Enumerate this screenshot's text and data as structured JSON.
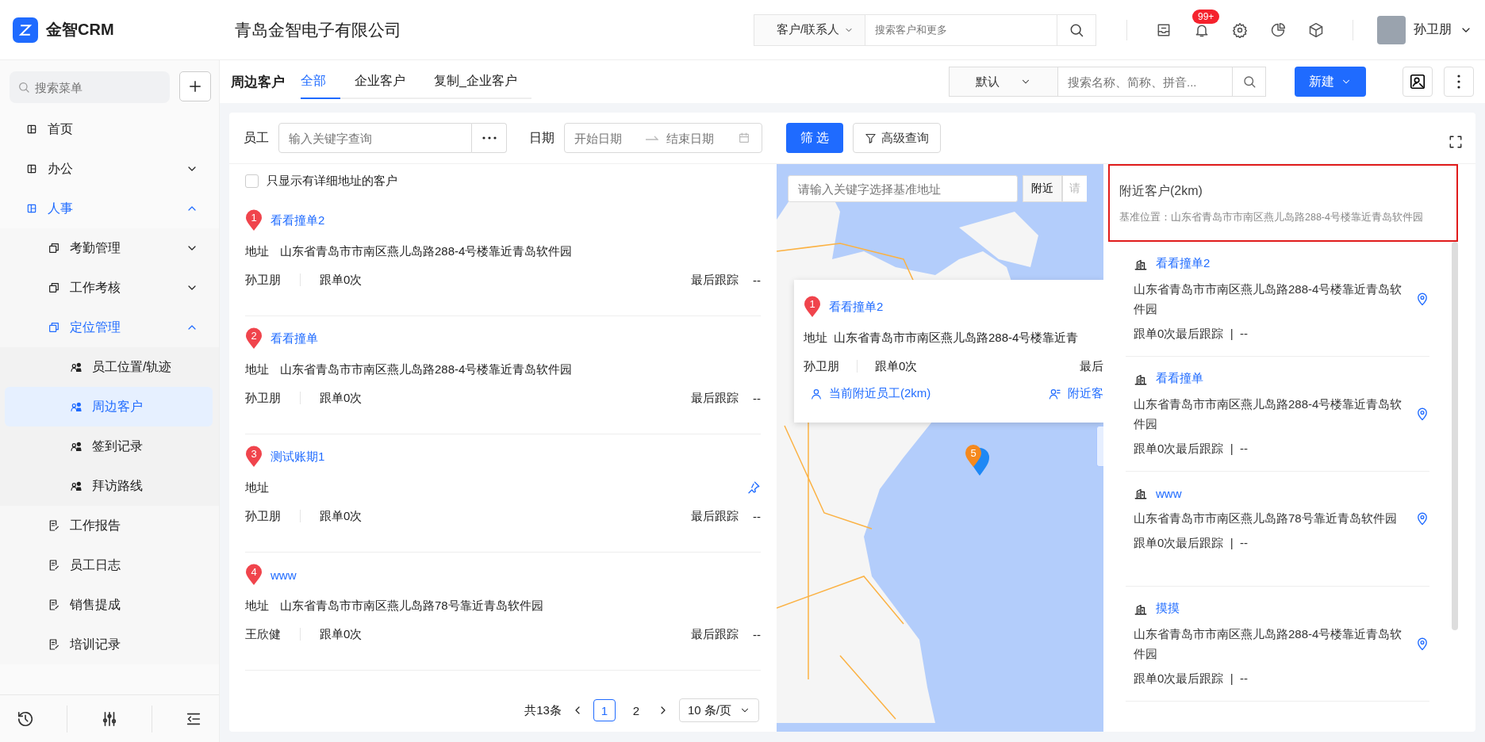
{
  "header": {
    "logo_text": "金智CRM",
    "company": "青岛金智电子有限公司",
    "search_scope": "客户/联系人",
    "search_placeholder": "搜索客户和更多",
    "notification_badge": "99+",
    "user_name": "孙卫朋"
  },
  "sidebar": {
    "search_placeholder": "搜索菜单",
    "items": [
      {
        "label": "首页",
        "kind": "leaf",
        "selected": false
      },
      {
        "label": "办公",
        "kind": "group",
        "expanded": false,
        "selected": false
      },
      {
        "label": "人事",
        "kind": "group",
        "expanded": true,
        "selected": false,
        "children": [
          {
            "label": "考勤管理",
            "kind": "group",
            "expanded": false,
            "selected": false
          },
          {
            "label": "工作考核",
            "kind": "group",
            "expanded": false,
            "selected": false
          },
          {
            "label": "定位管理",
            "kind": "group",
            "expanded": true,
            "selected": false,
            "children": [
              {
                "label": "员工位置/轨迹",
                "kind": "leaf",
                "selected": false
              },
              {
                "label": "周边客户",
                "kind": "leaf",
                "selected": true
              },
              {
                "label": "签到记录",
                "kind": "leaf",
                "selected": false
              },
              {
                "label": "拜访路线",
                "kind": "leaf",
                "selected": false
              }
            ]
          },
          {
            "label": "工作报告",
            "kind": "leaf",
            "selected": false
          },
          {
            "label": "员工日志",
            "kind": "leaf",
            "selected": false
          },
          {
            "label": "销售提成",
            "kind": "leaf",
            "selected": false
          },
          {
            "label": "培训记录",
            "kind": "leaf",
            "selected": false
          }
        ]
      }
    ]
  },
  "toolbar": {
    "title": "周边客户",
    "tabs": [
      {
        "label": "全部",
        "selected": true
      },
      {
        "label": "企业客户",
        "selected": false
      },
      {
        "label": "复制_企业客户",
        "selected": false
      }
    ],
    "view_select": "默认",
    "search_placeholder": "搜索名称、简称、拼音...",
    "new_button": "新建"
  },
  "filters": {
    "employee_label": "员工",
    "employee_placeholder": "输入关键字查询",
    "date_label": "日期",
    "start_placeholder": "开始日期",
    "end_placeholder": "结束日期",
    "filter_button": "筛 选",
    "advanced_button": "高级查询"
  },
  "list": {
    "checkbox": {
      "label": "只显示有详细地址的客户",
      "checked": false
    },
    "customers": [
      {
        "number": "1",
        "name": "看看撞单2",
        "address_label": "地址",
        "address": "山东省青岛市市南区燕儿岛路288-4号楼靠近青岛软件园",
        "owner": "孙卫朋",
        "follow": "跟单0次",
        "last_label": "最后跟踪",
        "last_value": "--"
      },
      {
        "number": "2",
        "name": "看看撞单",
        "address_label": "地址",
        "address": "山东省青岛市市南区燕儿岛路288-4号楼靠近青岛软件园",
        "owner": "孙卫朋",
        "follow": "跟单0次",
        "last_label": "最后跟踪",
        "last_value": "--"
      },
      {
        "number": "3",
        "name": "测试账期1",
        "address_label": "地址",
        "owner": "孙卫朋",
        "follow": "跟单0次",
        "last_label": "最后跟踪",
        "last_value": "--"
      },
      {
        "number": "4",
        "name": "www",
        "address_label": "地址",
        "address": "山东省青岛市市南区燕儿岛路78号靠近青岛软件园",
        "owner": "王欣健",
        "follow": "跟单0次",
        "last_label": "最后跟踪",
        "last_value": "--"
      }
    ]
  },
  "pagination": {
    "total": "共13条",
    "pages": [
      {
        "label": "1",
        "selected": true
      },
      {
        "label": "2",
        "selected": false
      }
    ],
    "page_size": "10 条/页"
  },
  "map": {
    "search_placeholder": "请输入关键字选择基准地址",
    "nearby_button": "附近",
    "cut_field": "请",
    "cluster": "5",
    "popup": {
      "number": "1",
      "name": "看看撞单2",
      "address_label": "地址",
      "address": "山东省青岛市市南区燕儿岛路288-4号楼靠近青",
      "owner": "孙卫朋",
      "follow": "跟单0次",
      "last_label": "最后",
      "employees_link": "当前附近员工(2km)",
      "customers_link": "附近客"
    }
  },
  "nearby": {
    "title": "附近客户(2km)",
    "base": "基准位置：山东省青岛市市南区燕儿岛路288-4号楼靠近青岛软件园",
    "customers": [
      {
        "name": "看看撞单2",
        "address": "山东省青岛市市南区燕儿岛路288-4号楼靠近青岛软件园",
        "follow": "跟单0次最后跟踪  |  --"
      },
      {
        "name": "看看撞单",
        "address": "山东省青岛市市南区燕儿岛路288-4号楼靠近青岛软件园",
        "follow": "跟单0次最后跟踪  |  --"
      },
      {
        "name": "www",
        "address": "山东省青岛市市南区燕儿岛路78号靠近青岛软件园",
        "follow": "跟单0次最后跟踪  |  --"
      },
      {
        "name": "摸摸",
        "address": "山东省青岛市市南区燕儿岛路288-4号楼靠近青岛软件园",
        "follow": "跟单0次最后跟踪  |  --"
      }
    ]
  }
}
